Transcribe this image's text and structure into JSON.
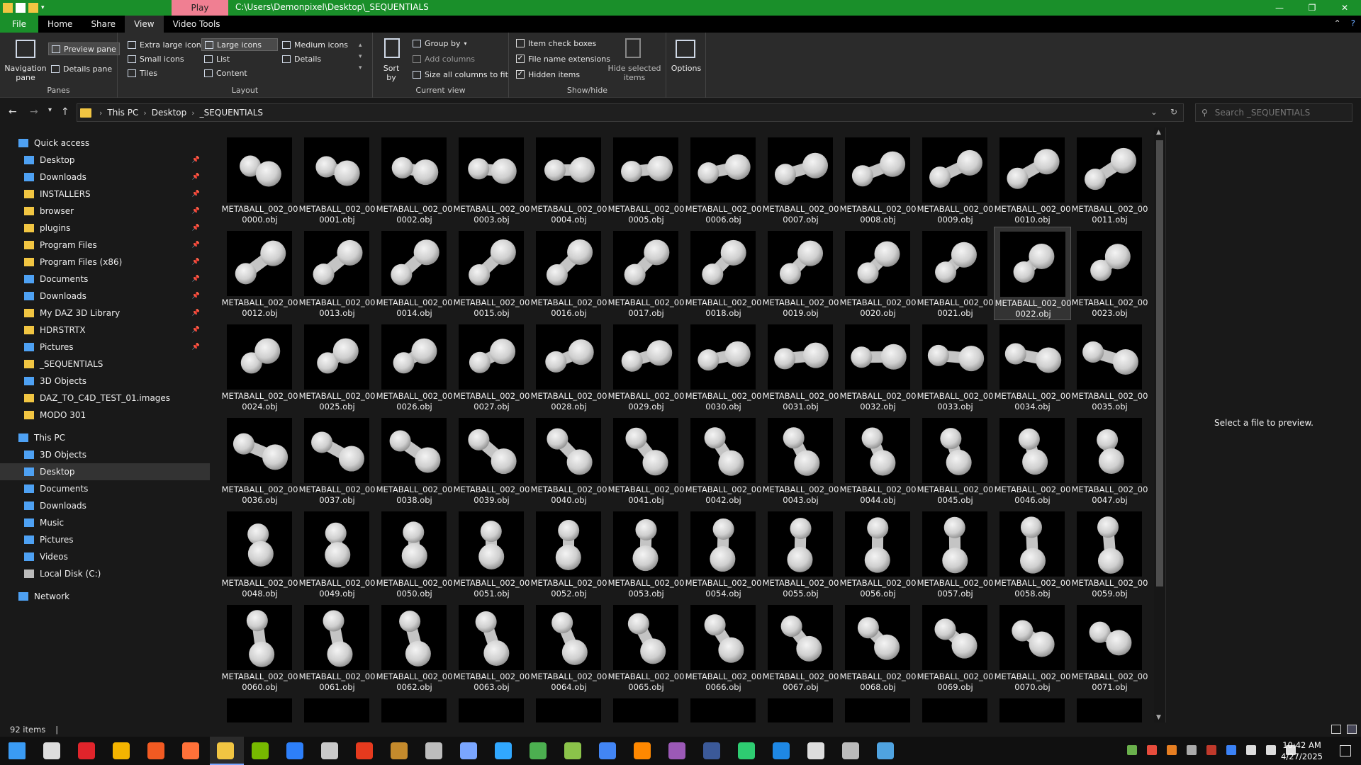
{
  "titlebar": {
    "play_tab": "Play",
    "path": "C:\\Users\\Demonpixel\\Desktop\\_SEQUENTIALS",
    "minimize": "—",
    "restore": "❐",
    "close": "✕"
  },
  "ribbon_tabs": {
    "file": "File",
    "home": "Home",
    "share": "Share",
    "view": "View",
    "video_tools": "Video Tools"
  },
  "ribbon": {
    "panes": {
      "label": "Panes",
      "navigation_pane": "Navigation pane",
      "preview_pane": "Preview pane",
      "details_pane": "Details pane"
    },
    "layout": {
      "label": "Layout",
      "extra_large": "Extra large icons",
      "large": "Large icons",
      "medium": "Medium icons",
      "small": "Small icons",
      "list": "List",
      "details": "Details",
      "tiles": "Tiles",
      "content": "Content"
    },
    "current_view": {
      "label": "Current view",
      "sort_by": "Sort by",
      "group_by": "Group by",
      "add_columns": "Add columns",
      "size_columns": "Size all columns to fit"
    },
    "show_hide": {
      "label": "Show/hide",
      "item_check_boxes": "Item check boxes",
      "file_name_extensions": "File name extensions",
      "hidden_items": "Hidden items",
      "hide_selected": "Hide selected items"
    },
    "options": "Options"
  },
  "address": {
    "crumbs": [
      "This PC",
      "Desktop",
      "_SEQUENTIALS"
    ],
    "search_placeholder": "Search _SEQUENTIALS"
  },
  "nav": {
    "quick_access": "Quick access",
    "quick_items": [
      "Desktop",
      "Downloads",
      "INSTALLERS",
      "browser",
      "plugins",
      "Program Files",
      "Program Files (x86)",
      "Documents",
      "Downloads",
      "My DAZ 3D Library",
      "HDRSTRTX",
      "Pictures",
      "_SEQUENTIALS",
      "3D Objects",
      "DAZ_TO_C4D_TEST_01.images",
      "MODO 301"
    ],
    "this_pc": "This PC",
    "pc_items": [
      "3D Objects",
      "Desktop",
      "Documents",
      "Downloads",
      "Music",
      "Pictures",
      "Videos",
      "Local Disk (C:)"
    ],
    "network": "Network"
  },
  "files": [
    "METABALL_002_000000.obj",
    "METABALL_002_000001.obj",
    "METABALL_002_000002.obj",
    "METABALL_002_000003.obj",
    "METABALL_002_000004.obj",
    "METABALL_002_000005.obj",
    "METABALL_002_000006.obj",
    "METABALL_002_000007.obj",
    "METABALL_002_000008.obj",
    "METABALL_002_000009.obj",
    "METABALL_002_000010.obj",
    "METABALL_002_000011.obj",
    "METABALL_002_000012.obj",
    "METABALL_002_000013.obj",
    "METABALL_002_000014.obj",
    "METABALL_002_000015.obj",
    "METABALL_002_000016.obj",
    "METABALL_002_000017.obj",
    "METABALL_002_000018.obj",
    "METABALL_002_000019.obj",
    "METABALL_002_000020.obj",
    "METABALL_002_000021.obj",
    "METABALL_002_000022.obj",
    "METABALL_002_000023.obj",
    "METABALL_002_000024.obj",
    "METABALL_002_000025.obj",
    "METABALL_002_000026.obj",
    "METABALL_002_000027.obj",
    "METABALL_002_000028.obj",
    "METABALL_002_000029.obj",
    "METABALL_002_000030.obj",
    "METABALL_002_000031.obj",
    "METABALL_002_000032.obj",
    "METABALL_002_000033.obj",
    "METABALL_002_000034.obj",
    "METABALL_002_000035.obj",
    "METABALL_002_000036.obj",
    "METABALL_002_000037.obj",
    "METABALL_002_000038.obj",
    "METABALL_002_000039.obj",
    "METABALL_002_000040.obj",
    "METABALL_002_000041.obj",
    "METABALL_002_000042.obj",
    "METABALL_002_000043.obj",
    "METABALL_002_000044.obj",
    "METABALL_002_000045.obj",
    "METABALL_002_000046.obj",
    "METABALL_002_000047.obj",
    "METABALL_002_000048.obj",
    "METABALL_002_000049.obj",
    "METABALL_002_000050.obj",
    "METABALL_002_000051.obj",
    "METABALL_002_000052.obj",
    "METABALL_002_000053.obj",
    "METABALL_002_000054.obj",
    "METABALL_002_000055.obj",
    "METABALL_002_000056.obj",
    "METABALL_002_000057.obj",
    "METABALL_002_000058.obj",
    "METABALL_002_000059.obj",
    "METABALL_002_000060.obj",
    "METABALL_002_000061.obj",
    "METABALL_002_000062.obj",
    "METABALL_002_000063.obj",
    "METABALL_002_000064.obj",
    "METABALL_002_000065.obj",
    "METABALL_002_000066.obj",
    "METABALL_002_000067.obj",
    "METABALL_002_000068.obj",
    "METABALL_002_000069.obj",
    "METABALL_002_000070.obj",
    "METABALL_002_000071.obj",
    "",
    "",
    "",
    "",
    "",
    "",
    "",
    "",
    "",
    "",
    "",
    ""
  ],
  "preview_message": "Select a file to preview.",
  "status": {
    "item_count": "92 items",
    "separator": "|"
  },
  "taskbar": {
    "time": "10:42 AM",
    "date": "4/27/2025"
  },
  "colors": {
    "titlebar": "#1a8f2a",
    "play_tab": "#f07f92",
    "folder": "#f1c542",
    "selection": "#333333"
  }
}
